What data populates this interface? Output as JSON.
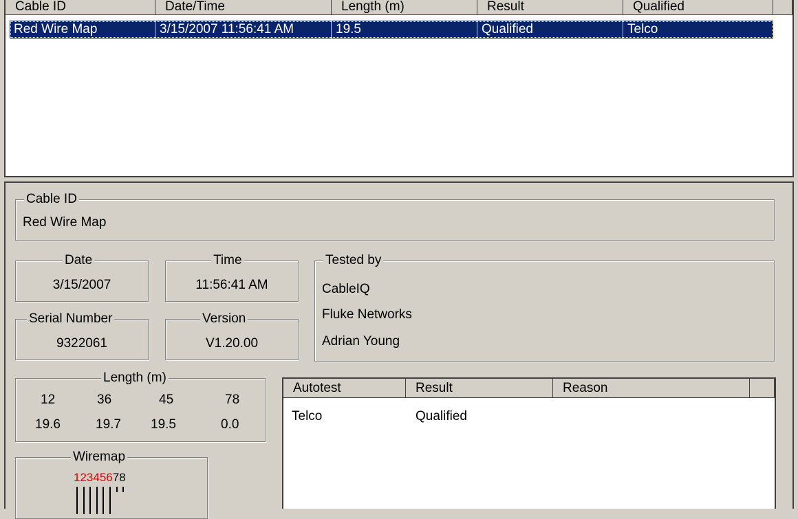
{
  "results_table": {
    "columns": [
      "Cable ID",
      "Date/Time",
      "Length (m)",
      "Result",
      "Qualified"
    ],
    "rows": [
      [
        "Red Wire Map",
        "3/15/2007 11:56:41 AM",
        "19.5",
        "Qualified",
        "Telco"
      ]
    ]
  },
  "detail": {
    "cable_id": {
      "label": "Cable ID",
      "value": "Red Wire Map"
    },
    "date": {
      "label": "Date",
      "value": "3/15/2007"
    },
    "time": {
      "label": "Time",
      "value": "11:56:41 AM"
    },
    "serial": {
      "label": "Serial Number",
      "value": "9322061"
    },
    "version": {
      "label": "Version",
      "value": "V1.20.00"
    },
    "tested_by": {
      "label": "Tested by",
      "lines": [
        "CableIQ",
        "Fluke Networks",
        "Adrian Young"
      ]
    },
    "length": {
      "label": "Length (m)",
      "pairs": [
        "12",
        "36",
        "45",
        "78"
      ],
      "values": [
        "19.6",
        "19.7",
        "19.5",
        "0.0"
      ]
    },
    "wiremap": {
      "label": "Wiremap",
      "pins_red": "123456",
      "pins_black": "78",
      "connected_pins": [
        1,
        2,
        3,
        4,
        5,
        6
      ],
      "open_pins": [
        7,
        8
      ],
      "red_color": "#e00000"
    }
  },
  "autotest_table": {
    "columns": [
      "Autotest",
      "Result",
      "Reason"
    ],
    "rows": [
      [
        "Telco",
        "Qualified",
        ""
      ]
    ]
  },
  "colors": {
    "selection": "#0a246a",
    "face": "#d4d0c8"
  }
}
